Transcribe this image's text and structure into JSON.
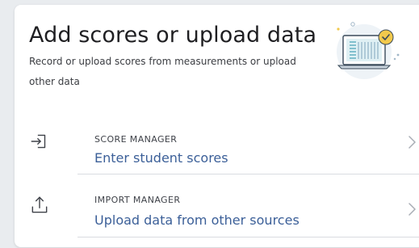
{
  "header": {
    "title": "Add scores or upload data",
    "subtitle": "Record or upload scores from measurements or upload other data",
    "illustration_icon": "laptop-with-checkmark-illustration"
  },
  "rows": [
    {
      "kicker": "SCORE MANAGER",
      "link": "Enter student scores",
      "icon": "sign-in-icon"
    },
    {
      "kicker": "IMPORT MANAGER",
      "link": "Upload data from other sources",
      "icon": "upload-icon"
    }
  ],
  "colors": {
    "link": "#3b5f98",
    "accent_yellow": "#f2c94c",
    "illustration_teal": "#4aa3b8"
  }
}
